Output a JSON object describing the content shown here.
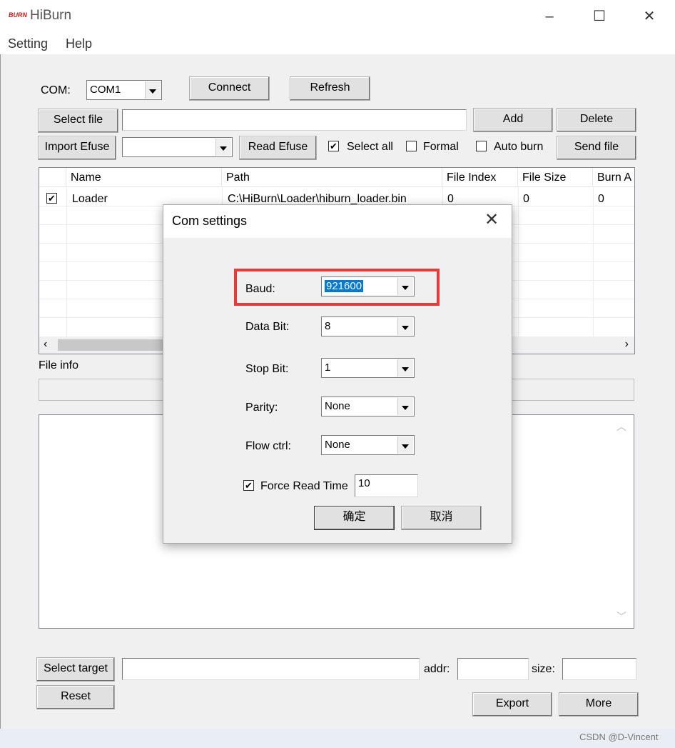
{
  "app": {
    "title": "HiBurn",
    "logo_text": "BURN"
  },
  "window_controls": {
    "minimize": "–",
    "maximize": "☐",
    "close": "✕"
  },
  "menu": {
    "items": [
      "Setting",
      "Help"
    ]
  },
  "toolbar": {
    "com_label": "COM:",
    "com_value": "COM1",
    "connect": "Connect",
    "refresh": "Refresh",
    "select_file": "Select file",
    "add": "Add",
    "delete": "Delete",
    "import_efuse": "Import Efuse",
    "read_efuse": "Read Efuse",
    "select_all": "Select all",
    "formal": "Formal",
    "auto_burn": "Auto burn",
    "send_file": "Send file"
  },
  "table": {
    "columns": [
      "",
      "Name",
      "Path",
      "File Index",
      "File Size",
      "Burn A"
    ],
    "rows": [
      {
        "checked": true,
        "name": "Loader",
        "path": "C:\\HiBurn\\Loader\\hiburn_loader.bin",
        "file_index": "0",
        "file_size": "0",
        "burn_addr": "0"
      }
    ]
  },
  "file_info": {
    "label": "File info"
  },
  "bottom": {
    "select_target": "Select target",
    "addr_label": "addr:",
    "size_label": "size:",
    "reset": "Reset",
    "export": "Export",
    "more": "More"
  },
  "dialog": {
    "title": "Com settings",
    "baud_label": "Baud:",
    "baud_value": "921600",
    "data_bit_label": "Data Bit:",
    "data_bit_value": "8",
    "stop_bit_label": "Stop Bit:",
    "stop_bit_value": "1",
    "parity_label": "Parity:",
    "parity_value": "None",
    "flow_label": "Flow ctrl:",
    "flow_value": "None",
    "force_read_label": "Force Read Time",
    "force_read_value": "10",
    "ok": "确定",
    "cancel": "取消",
    "highlight_color": "#e83a3a"
  },
  "watermark": "CSDN @D-Vincent"
}
